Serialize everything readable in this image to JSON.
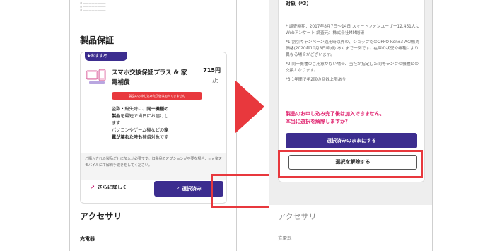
{
  "left": {
    "tiny_text": [
      "※ ————————",
      "※ ————————",
      "※ ————————"
    ],
    "section_title": "製品保証",
    "badge": {
      "star": "★",
      "label": "おすすめ"
    },
    "product": {
      "name": "スマホ交換保証プラス & 家電補償",
      "price": "715円",
      "per_month": "/月",
      "warning": "製品のお申し込み完了後は加入できません",
      "desc_lines": [
        [
          "盗難・紛失時に、",
          "同一機種の"
        ],
        [
          "製品",
          "を最短で当日にお届けし"
        ],
        [
          "ます",
          ""
        ],
        [
          "パソコンやゲーム機などの",
          "家"
        ],
        [
          "電が壊れた時も",
          "補償対象です"
        ]
      ]
    },
    "note": "ご購入される製品ごとに加入が必要です。旧製品でオプションが不要な場合、my 楽天モバイルにて解約手続きをしてください。",
    "detail_link": "さらに詳しく",
    "detail_icon": "external-link-icon",
    "selected_button": "選択済み",
    "check_icon": "check-icon",
    "accessory_title": "アクセサリ",
    "charger_label": "充電器"
  },
  "right": {
    "head": "対象（*3）",
    "notes": [
      "* 調査時期：2017年8月7日〜14日 スマートフォンユーザー12,451人にWebアンケート 調査元：株式会社MM総研",
      "*1 割引キャンペーン適用時以外の、ショップでのOPPO Reno3 Aの販売価格(2020年10月8日時点) あくまで一例です。在庫の状況や機種により異なる場合がございます。",
      "*2 同一機種のご用意がない場合、当社が指定した同等ランクの機種との交換となります。",
      "*3 1年間で年2回の回数上限あり"
    ],
    "warning_line1": "製品のお申し込み完了後は加入できません。",
    "warning_line2": "本当に選択を解除しますか？",
    "keep_button": "選択済みのままにする",
    "cancel_button": "選択を解除する",
    "accessory_title": "アクセサリ",
    "charger_label": "充電器"
  },
  "colors": {
    "primary": "#3c2d8f",
    "warning": "#e8383d",
    "magenta": "#e0226e",
    "highlight": "#e8383d"
  }
}
